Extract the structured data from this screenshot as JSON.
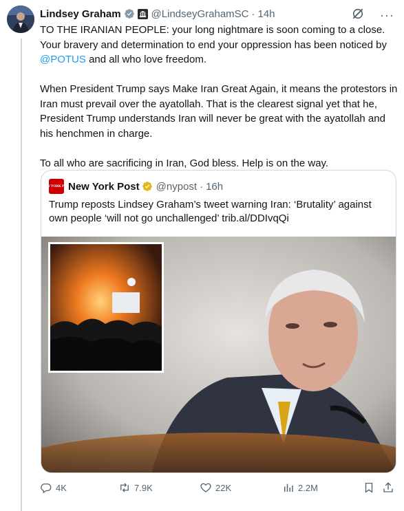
{
  "tweet": {
    "author_name": "Lindsey Graham",
    "handle": "@LindseyGrahamSC",
    "separator": "·",
    "time": "14h",
    "more_label": "···",
    "para1_a": "TO THE IRANIAN PEOPLE: your long nightmare is soon coming to a close. Your bravery and determination to end your oppression has been noticed by ",
    "mention": "@POTUS",
    "para1_b": " and all who love freedom.",
    "para2": "When President Trump says Make Iran Great Again, it means the protestors in Iran must prevail over the ayatollah. That is the clearest signal yet that he, President Trump understands Iran will never be great with the ayatollah and his henchmen in charge.",
    "para3": "To all who are sacrificing in Iran, God bless. Help is on the way."
  },
  "quote": {
    "logo_text": "NEW YORK POST",
    "author_name": "New York Post",
    "handle": "@nypost",
    "separator": "·",
    "time": "16h",
    "text": "Trump reposts Lindsey Graham’s tweet warning Iran: ‘Brutality’ against own people ‘will not go unchallenged’ trib.al/DDIvqQi"
  },
  "actions": {
    "replies": "4K",
    "reposts": "7.9K",
    "likes": "22K",
    "views": "2.2M"
  },
  "colors": {
    "accent": "#1d9bf0",
    "verified_blue": "#1d9bf0",
    "verified_gold": "#e2b719",
    "nyp_red": "#cc0000",
    "muted_text": "#536471"
  },
  "icons": [
    "verified-badge-icon",
    "government-badge-icon",
    "grok-icon",
    "more-icon",
    "gold-verified-icon",
    "reply-icon",
    "repost-icon",
    "like-icon",
    "views-icon",
    "bookmark-icon",
    "share-icon"
  ]
}
